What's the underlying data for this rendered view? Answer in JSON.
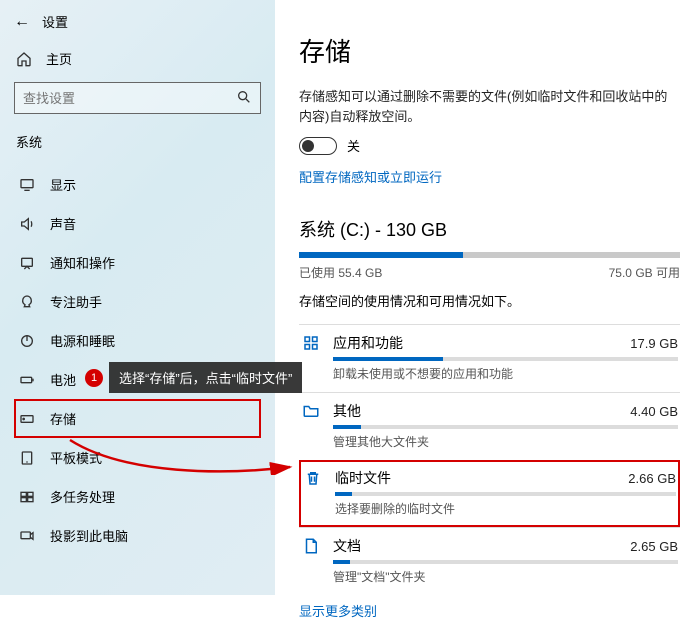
{
  "header": {
    "back": "←",
    "title": "设置"
  },
  "home": {
    "label": "主页"
  },
  "search": {
    "placeholder": "查找设置"
  },
  "section": "系统",
  "nav": [
    {
      "label": "显示"
    },
    {
      "label": "声音"
    },
    {
      "label": "通知和操作"
    },
    {
      "label": "专注助手"
    },
    {
      "label": "电源和睡眠"
    },
    {
      "label": "电池"
    },
    {
      "label": "存储"
    },
    {
      "label": "平板模式"
    },
    {
      "label": "多任务处理"
    },
    {
      "label": "投影到此电脑"
    }
  ],
  "callout": {
    "num": "1",
    "text": "选择“存储”后，点击“临时文件”"
  },
  "page": {
    "title": "存储",
    "desc": "存储感知可以通过删除不需要的文件(例如临时文件和回收站中的内容)自动释放空间。",
    "toggle_label": "关",
    "config_link": "配置存储感知或立即运行",
    "drive": {
      "title": "系统 (C:) - 130 GB",
      "used_pct": 43,
      "used_label": "已使用 55.4 GB",
      "free_label": "75.0 GB 可用"
    },
    "usage_desc": "存储空间的使用情况和可用情况如下。",
    "cats": [
      {
        "name": "应用和功能",
        "size": "17.9 GB",
        "pct": 32,
        "sub": "卸载未使用或不想要的应用和功能"
      },
      {
        "name": "其他",
        "size": "4.40 GB",
        "pct": 8,
        "sub": "管理其他大文件夹"
      },
      {
        "name": "临时文件",
        "size": "2.66 GB",
        "pct": 5,
        "sub": "选择要删除的临时文件"
      },
      {
        "name": "文档",
        "size": "2.65 GB",
        "pct": 5,
        "sub": "管理\"文档\"文件夹"
      }
    ],
    "more_link": "显示更多类别"
  }
}
